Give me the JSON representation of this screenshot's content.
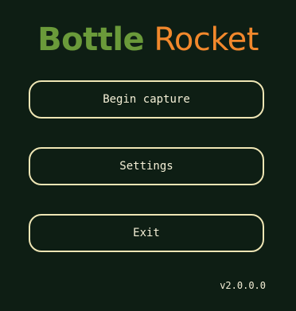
{
  "app": {
    "title_part1": "Bottle",
    "title_part2": "Rocket"
  },
  "menu": {
    "begin_capture_label": "Begin capture",
    "settings_label": "Settings",
    "exit_label": "Exit"
  },
  "version": "v2.0.0.0",
  "colors": {
    "background": "#0e1e14",
    "title_primary": "#6a9a3a",
    "title_secondary": "#f2882c",
    "button_border": "#efe6b5",
    "button_text": "#f4efd6"
  }
}
